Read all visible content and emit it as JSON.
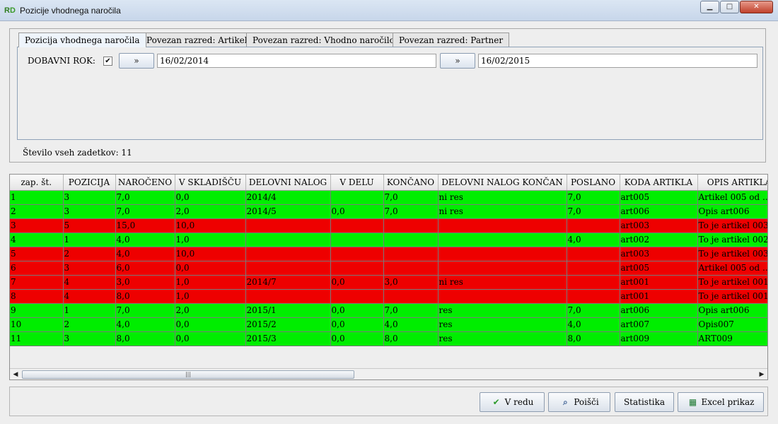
{
  "window": {
    "title": "Pozicije vhodnega naročila",
    "icon_letters": [
      "R",
      "D"
    ]
  },
  "window_controls": {
    "minimize": "▁",
    "maximize": "□",
    "close": "✕"
  },
  "tabs": [
    {
      "label": "Pozicija vhodnega naročila",
      "active": true
    },
    {
      "label": "Povezan razred: Artikel",
      "active": false
    },
    {
      "label": "Povezan razred: Vhodno naročilo",
      "active": false
    },
    {
      "label": "Povezan razred: Partner",
      "active": false
    }
  ],
  "filter": {
    "label": "DOBAVNI ROK:",
    "checked_glyph": "✔",
    "arrow_glyph": "»",
    "date_from": "16/02/2014",
    "date_to": "16/02/2015"
  },
  "record_count": "Število vseh zadetkov: 11",
  "table": {
    "headers": [
      "zap. št.",
      "POZICIJA",
      "NAROČENO",
      "V SKLADIŠČU",
      "DELOVNI NALOG",
      "V DELU",
      "KONČANO",
      "DELOVNI NALOG KONČAN",
      "POSLANO",
      "KODA ARTIKLA",
      "OPIS ARTIKLA"
    ],
    "rows": [
      {
        "status": "green",
        "cells": [
          "1",
          "3",
          "7,0",
          "0,0",
          "2014/4",
          "",
          "7,0",
          "ni res",
          "7,0",
          "art005",
          "Artikel 005 od ..."
        ]
      },
      {
        "status": "green",
        "cells": [
          "2",
          "3",
          "7,0",
          "2,0",
          "2014/5",
          "0,0",
          "7,0",
          "ni res",
          "7,0",
          "art006",
          "Opis art006"
        ]
      },
      {
        "status": "red",
        "cells": [
          "3",
          "5",
          "15,0",
          "10,0",
          "",
          "",
          "",
          "",
          "",
          "art003",
          "To je artikel 003"
        ]
      },
      {
        "status": "green",
        "cells": [
          "4",
          "1",
          "4,0",
          "1,0",
          "",
          "",
          "",
          "",
          "4,0",
          "art002",
          "To je artikel 002"
        ]
      },
      {
        "status": "red",
        "cells": [
          "5",
          "2",
          "4,0",
          "10,0",
          "",
          "",
          "",
          "",
          "",
          "art003",
          "To je artikel 003"
        ]
      },
      {
        "status": "red",
        "cells": [
          "6",
          "3",
          "6,0",
          "0,0",
          "",
          "",
          "",
          "",
          "",
          "art005",
          "Artikel 005 od ..."
        ]
      },
      {
        "status": "red",
        "cells": [
          "7",
          "4",
          "3,0",
          "1,0",
          "2014/7",
          "0,0",
          "3,0",
          "ni res",
          "",
          "art001",
          "To je artikel 001"
        ]
      },
      {
        "status": "red",
        "cells": [
          "8",
          "4",
          "8,0",
          "1,0",
          "",
          "",
          "",
          "",
          "",
          "art001",
          "To je artikel 001"
        ]
      },
      {
        "status": "green",
        "cells": [
          "9",
          "1",
          "7,0",
          "2,0",
          "2015/1",
          "0,0",
          "7,0",
          "res",
          "7,0",
          "art006",
          "Opis art006"
        ]
      },
      {
        "status": "green",
        "cells": [
          "10",
          "2",
          "4,0",
          "0,0",
          "2015/2",
          "0,0",
          "4,0",
          "res",
          "4,0",
          "art007",
          "Opis007"
        ]
      },
      {
        "status": "green",
        "cells": [
          "11",
          "3",
          "8,0",
          "0,0",
          "2015/3",
          "0,0",
          "8,0",
          "res",
          "8,0",
          "art009",
          "ART009"
        ]
      }
    ]
  },
  "colors": {
    "row_green": "#00ee00",
    "row_red": "#ee0000"
  },
  "scrollbar": {
    "left_glyph": "◀",
    "right_glyph": "▶",
    "thumb_glyph": "|||"
  },
  "buttons": {
    "ok": {
      "label": "V redu",
      "icon": "check-icon",
      "glyph": "✔"
    },
    "search": {
      "label": "Poišči",
      "icon": "magnifier-icon",
      "glyph": "⌕"
    },
    "stats": {
      "label": "Statistika"
    },
    "excel": {
      "label": "Excel prikaz",
      "icon": "excel-icon",
      "glyph": "▦"
    }
  }
}
